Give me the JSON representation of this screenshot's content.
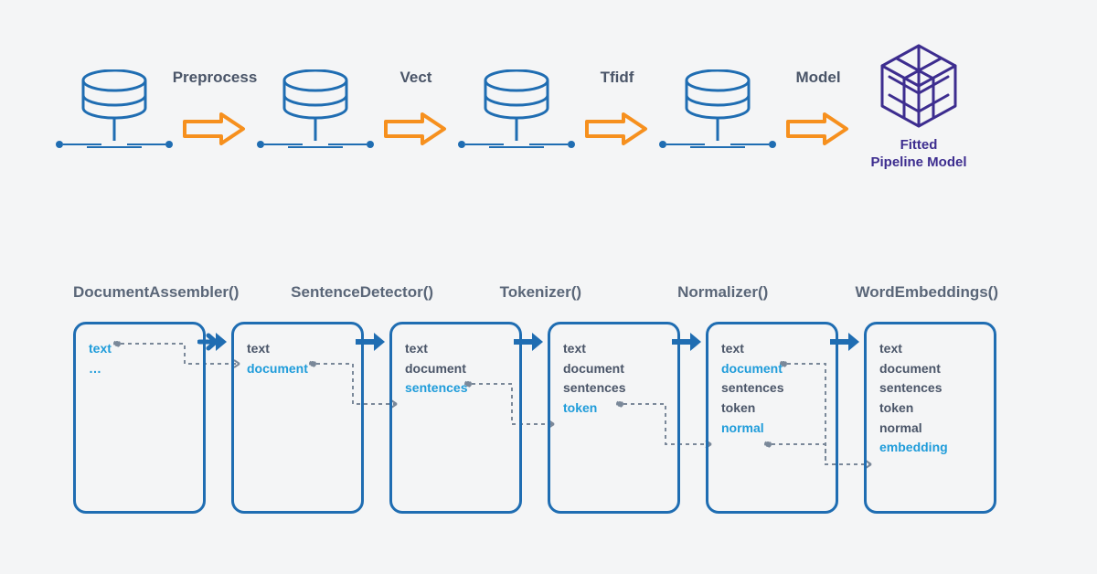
{
  "top": {
    "stages": [
      "Preprocess",
      "Vect",
      "Tfidf",
      "Model"
    ],
    "final_label_line1": "Fitted",
    "final_label_line2": "Pipeline Model"
  },
  "bottom": {
    "titles": [
      "DocumentAssembler()",
      "SentenceDetector()",
      "Tokenizer()",
      "Normalizer()",
      "WordEmbeddings()"
    ],
    "cards": [
      {
        "items": [
          {
            "text": "text",
            "hl": true
          },
          {
            "text": "…",
            "hl": true
          }
        ]
      },
      {
        "items": [
          {
            "text": "text",
            "hl": false
          },
          {
            "text": "document",
            "hl": true
          }
        ]
      },
      {
        "items": [
          {
            "text": "text",
            "hl": false
          },
          {
            "text": "document",
            "hl": false
          },
          {
            "text": "sentences",
            "hl": true
          }
        ]
      },
      {
        "items": [
          {
            "text": "text",
            "hl": false
          },
          {
            "text": "document",
            "hl": false
          },
          {
            "text": "sentences",
            "hl": false
          },
          {
            "text": "token",
            "hl": true
          }
        ]
      },
      {
        "items": [
          {
            "text": "text",
            "hl": false
          },
          {
            "text": "document",
            "hl": true
          },
          {
            "text": "sentences",
            "hl": false
          },
          {
            "text": "token",
            "hl": false
          },
          {
            "text": "normal",
            "hl": true
          }
        ]
      },
      {
        "items": [
          {
            "text": "text",
            "hl": false
          },
          {
            "text": "document",
            "hl": false
          },
          {
            "text": "sentences",
            "hl": false
          },
          {
            "text": "token",
            "hl": false
          },
          {
            "text": "normal",
            "hl": false
          },
          {
            "text": "embedding",
            "hl": true
          }
        ]
      }
    ]
  },
  "colors": {
    "blue": "#1f6db2",
    "orange": "#f6901e",
    "purple": "#3d2d8f",
    "cyan": "#1f9cda",
    "gray": "#4a5568"
  }
}
